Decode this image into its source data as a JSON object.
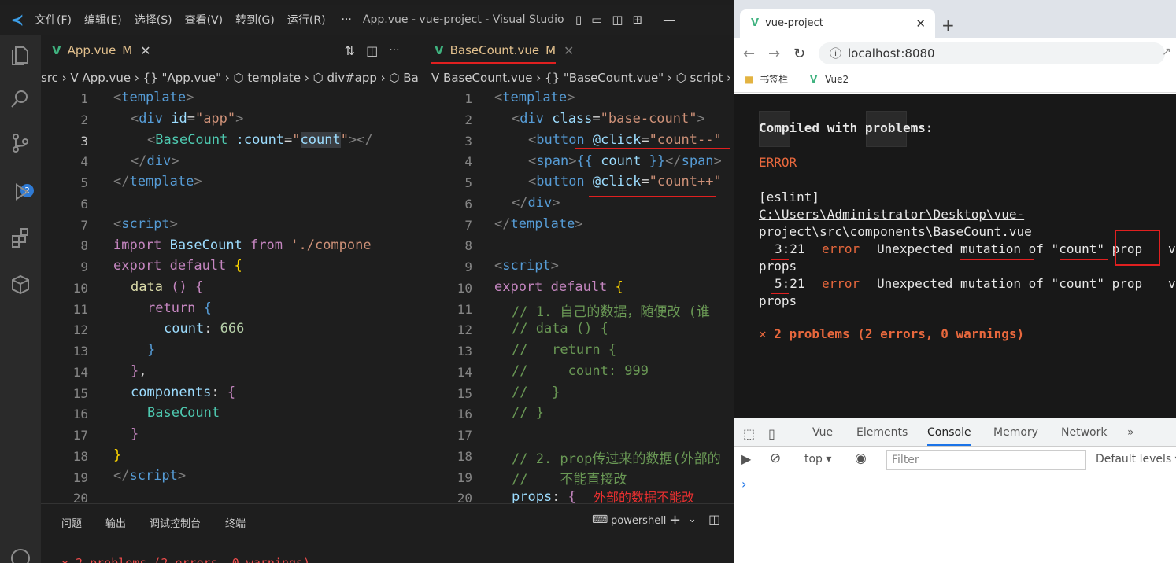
{
  "vscode": {
    "menus": [
      "文件(F)",
      "编辑(E)",
      "选择(S)",
      "查看(V)",
      "转到(G)",
      "运行(R)"
    ],
    "more": "···",
    "window_title": "App.vue - vue-project - Visual Studio ...",
    "tab1": {
      "v": "V",
      "name": "App.vue",
      "mod": "M",
      "close": "✕"
    },
    "tab2": {
      "v": "V",
      "name": "BaseCount.vue",
      "mod": "M",
      "close": "✕"
    },
    "bc1": "src › V App.vue › {} \"App.vue\" › ⬡ template › ⬡ div#app › ⬡ Ba",
    "bc2": "V BaseCount.vue › {} \"BaseCount.vue\" › ⬡ script ›",
    "line_numbers": [
      "1",
      "2",
      "3",
      "4",
      "5",
      "6",
      "7",
      "8",
      "9",
      "10",
      "11",
      "12",
      "13",
      "14",
      "15",
      "16",
      "17",
      "18",
      "19",
      "20"
    ],
    "panel_tabs": [
      "问题",
      "输出",
      "调试控制台",
      "终端"
    ],
    "terminal": "powershell",
    "panel_err": "✕ 2 problems (2 errors, 0 warnings)",
    "annotation": "外部的数据不能改"
  },
  "chrome": {
    "tab_title": "vue-project",
    "tab_close": "✕",
    "new_tab": "+",
    "url": "localhost:8080",
    "bookmarks": [
      "书签栏",
      "Vue2"
    ],
    "overlay": {
      "title": "Compiled with problems:",
      "error": "ERROR",
      "source": "[eslint]",
      "path1": "C:\\Users\\Administrator\\Desktop\\vue-",
      "path2": "project\\src\\components\\BaseCount.vue",
      "e1_loc": "3:21",
      "e1_kind": "error",
      "e1_msg": "Unexpected mutation of \"count\" prop",
      "e1_tail": "v",
      "e1_wrap": "props",
      "e2_loc": "5:21",
      "e2_kind": "error",
      "e2_msg": "Unexpected mutation of \"count\" prop",
      "e2_tail": "v",
      "e2_wrap": "props",
      "summary": "✕ 2 problems (2 errors, 0 warnings)"
    },
    "devtools_tabs": [
      "Vue",
      "Elements",
      "Console",
      "Memory",
      "Network",
      "»"
    ],
    "context": "top ▾",
    "filter_placeholder": "Filter",
    "levels": "Default levels ▾",
    "prompt": "›"
  },
  "colors": {
    "accent": "#3fb27f",
    "error": "#e02020",
    "overlay_bg": "#181818"
  }
}
